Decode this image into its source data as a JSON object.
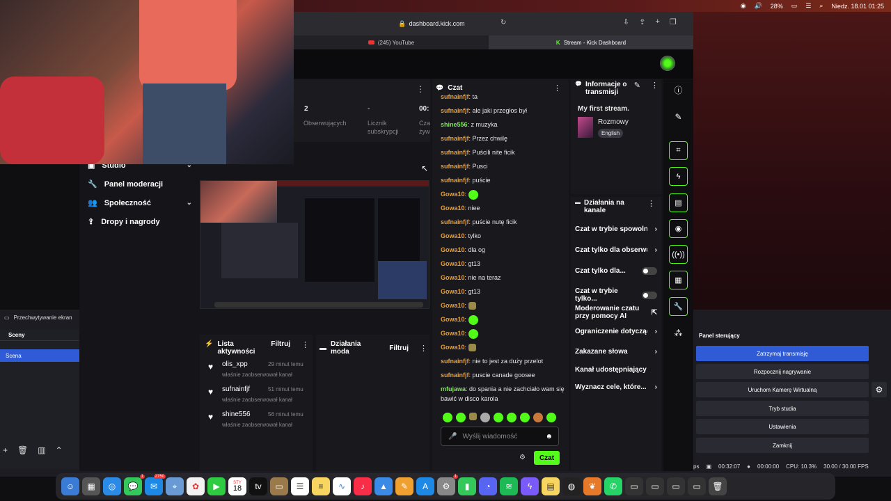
{
  "menubar": {
    "battery": "28%",
    "datetime": "Niedz. 18.01  01:25"
  },
  "browser": {
    "url": "dashboard.kick.com",
    "tabs": [
      {
        "label": "(245) YouTube"
      },
      {
        "label": "Stream - Kick Dashboard"
      }
    ]
  },
  "stats": {
    "values": [
      "2",
      "-",
      "00:"
    ],
    "labels": [
      "Obserwujących",
      "Licznik subskrypcji",
      "Cza żyw"
    ]
  },
  "sidebar": {
    "items": [
      {
        "label": "Studio"
      },
      {
        "label": "Panel moderacji"
      },
      {
        "label": "Społeczność"
      },
      {
        "label": "Dropy i nagrody"
      }
    ]
  },
  "activity": {
    "title": "Lista aktywności",
    "filter": "Filtruj",
    "items": [
      {
        "name": "olis_xpp",
        "time": "29 minut temu",
        "text": "właśnie zaobserwował kanał"
      },
      {
        "name": "sufnainfjf",
        "time": "51 minut temu",
        "text": "właśnie zaobserwował kanał"
      },
      {
        "name": "shine556",
        "time": "56 minut temu",
        "text": "właśnie zaobserwował kanał"
      }
    ]
  },
  "mod_actions": {
    "title": "Działania moda",
    "filter": "Filtruj"
  },
  "chat": {
    "title": "Czat",
    "messages": [
      {
        "user": "sufnainfjf",
        "text": "ta"
      },
      {
        "user": "sufnainfjf",
        "text": "ale jaki przegłos był"
      },
      {
        "user": "shine556",
        "text": "z muzyka"
      },
      {
        "user": "sufnainfjf",
        "text": "Przez chwilę"
      },
      {
        "user": "sufnainfjf",
        "text": "Puścili nite ficik"
      },
      {
        "user": "sufnainfjf",
        "text": "Pusci"
      },
      {
        "user": "sufnainfjf",
        "text": "puście"
      },
      {
        "user": "Gowa10",
        "text": ""
      },
      {
        "user": "Gowa10",
        "text": "niee"
      },
      {
        "user": "sufnainfjf",
        "text": "puście nutę ficik"
      },
      {
        "user": "Gowa10",
        "text": "tylko"
      },
      {
        "user": "Gowa10",
        "text": "dla og"
      },
      {
        "user": "Gowa10",
        "text": "gt13"
      },
      {
        "user": "Gowa10",
        "text": "nie na teraz"
      },
      {
        "user": "Gowa10",
        "text": "gt13"
      },
      {
        "user": "Gowa10",
        "text": ""
      },
      {
        "user": "Gowa10",
        "text": ""
      },
      {
        "user": "Gowa10",
        "text": ""
      },
      {
        "user": "Gowa10",
        "text": ""
      },
      {
        "user": "sufnainfjf",
        "text": "nie to jest za duży przelot"
      },
      {
        "user": "sufnainfjf",
        "text": "puscie canade goosee"
      },
      {
        "user": "mfujawa",
        "text": "do spania a nie zachciało wam się bawić w disco karola"
      }
    ],
    "input_placeholder": "Wyślij wiadomość",
    "send_label": "Czat"
  },
  "info": {
    "title": "Informacje o transmisji",
    "stream_title": "My first stream.",
    "category": "Rozmowy",
    "language": "English"
  },
  "channel_actions": {
    "title": "Działania na kanale",
    "items": [
      {
        "label": "Czat w trybie spowolni"
      },
      {
        "label": "Czat tylko dla obserwu"
      },
      {
        "label": "Czat tylko dla..."
      },
      {
        "label": "Czat w trybie tylko..."
      },
      {
        "label": "Moderowanie czatu przy pomocy AI"
      },
      {
        "label": "Ograniczenie dotycząc"
      },
      {
        "label": "Zakazane słowa"
      },
      {
        "label": "Kanał udostępniający"
      },
      {
        "label": "Wyznacz cele, które..."
      }
    ]
  },
  "obs": {
    "capture_source": "Przechwytywanie ekran",
    "scenes_title": "Sceny",
    "scene": "Scena",
    "controls_title": "Panel sterujący",
    "buttons": [
      "Zatrzymaj transmisję",
      "Rozpocznij nagrywanie",
      "Uruchom Kamerę Wirtualną",
      "Tryb studia",
      "Ustawienia",
      "Zamknij"
    ],
    "status": {
      "stream_time": "00:32:07",
      "rec_time": "00:00:00",
      "cpu": "CPU: 10.3%",
      "fps": "30.00 / 30.00 FPS",
      "fragment": "ps"
    }
  },
  "dock": {
    "badges": {
      "messages": "1",
      "mail": "2750",
      "settings": "1"
    },
    "calendar": {
      "month": "STY",
      "day": "18"
    }
  },
  "colors": {
    "kick_green": "#53fc18",
    "obs_blue": "#2f5bd6"
  }
}
